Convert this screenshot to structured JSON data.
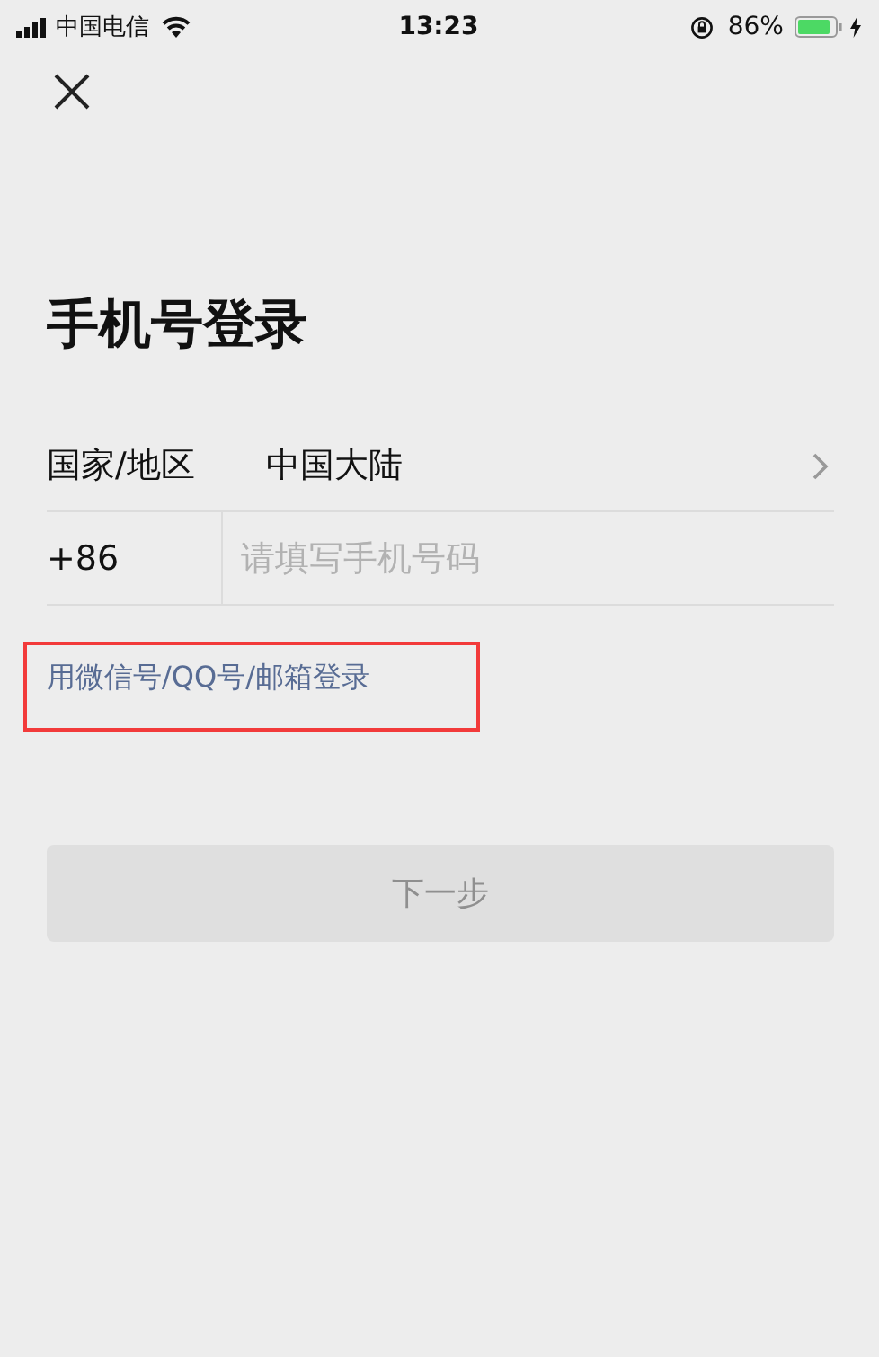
{
  "status_bar": {
    "carrier": "中国电信",
    "time": "13:23",
    "battery_percent": "86%"
  },
  "title": "手机号登录",
  "region_row": {
    "label": "国家/地区",
    "value": "中国大陆"
  },
  "phone_row": {
    "code": "+86",
    "placeholder": "请填写手机号码"
  },
  "alt_login_link": {
    "label": "用微信号/QQ号/邮箱登录",
    "highlighted": true
  },
  "next_button": {
    "label": "下一步",
    "disabled": true
  }
}
